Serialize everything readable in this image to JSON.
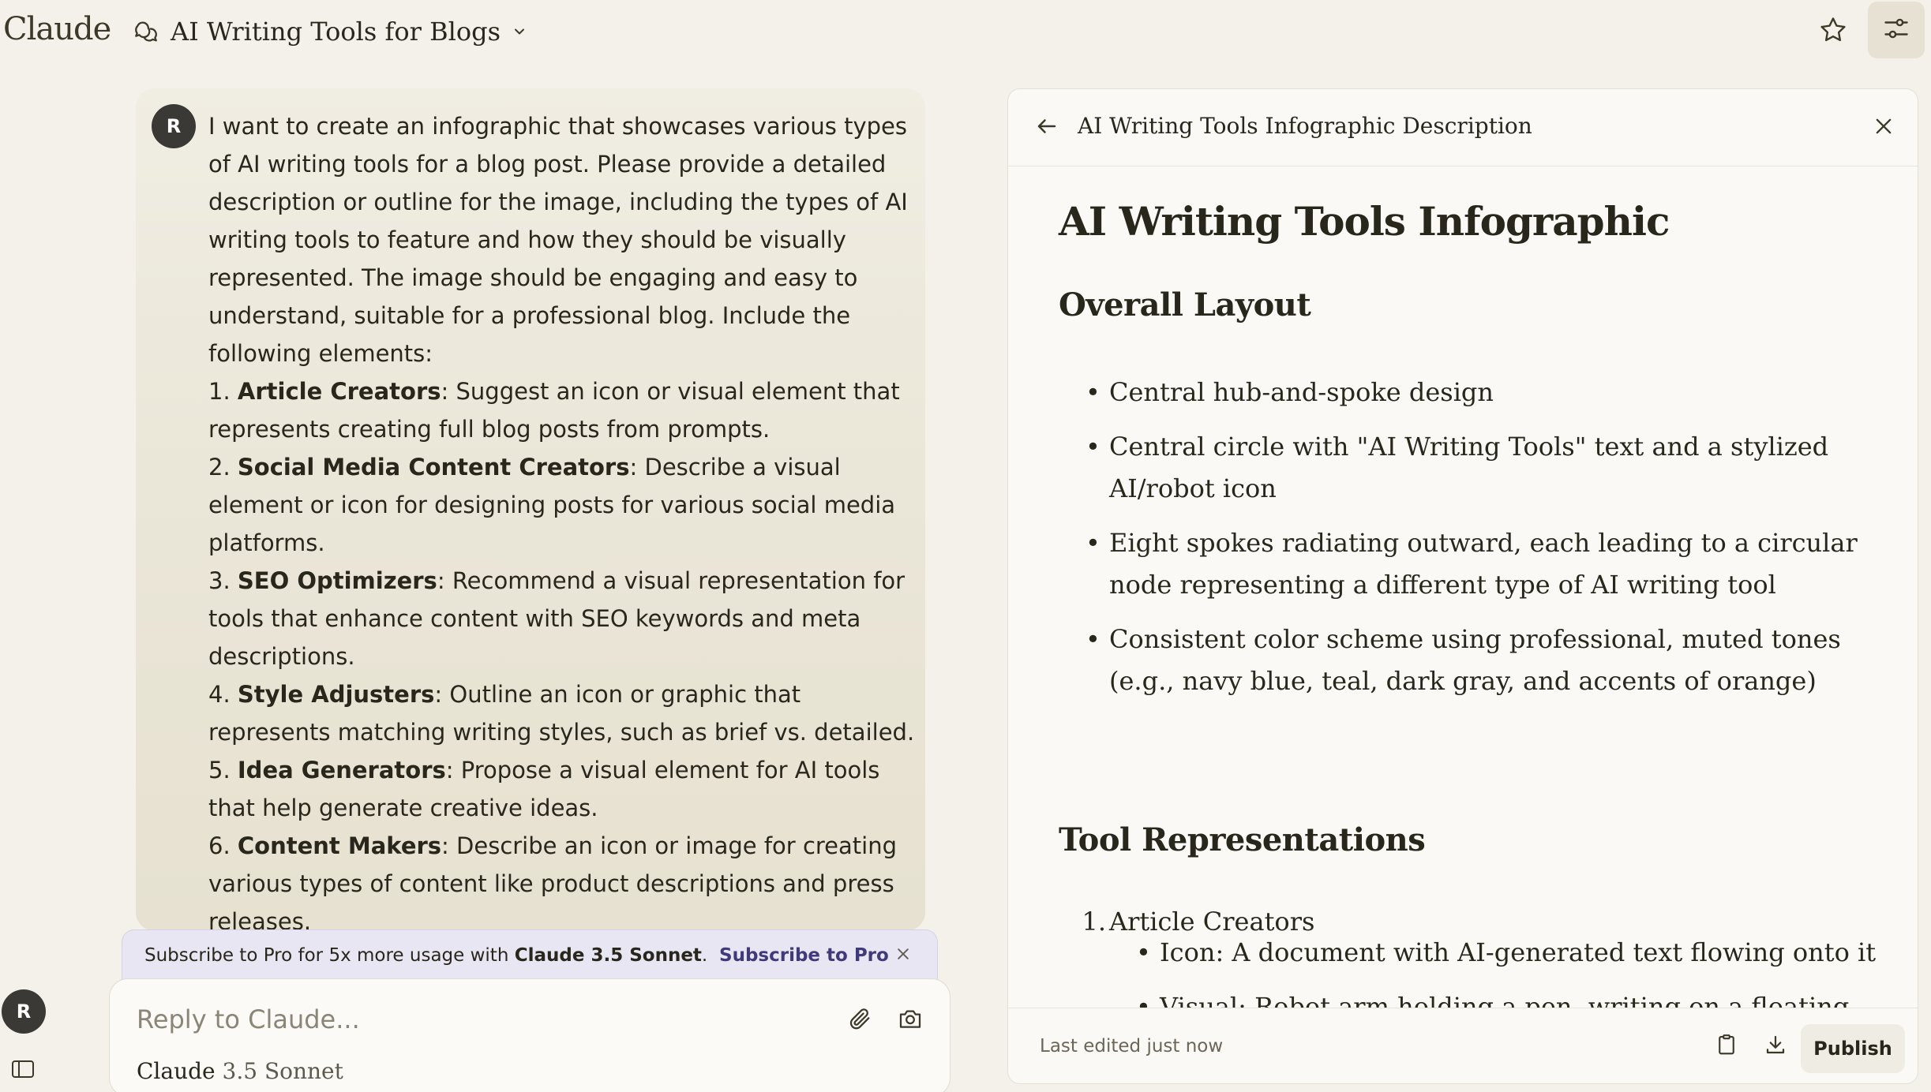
{
  "app": {
    "logo": "Claude"
  },
  "header": {
    "chat_title": "AI Writing Tools for Blogs"
  },
  "message": {
    "avatar": "R",
    "intro": "I want to create an infographic that showcases various types of AI writing tools for a blog post. Please provide a detailed description or outline for the image, including the types of AI writing tools to feature and how they should be visually represented. The image should be engaging and easy to understand, suitable for a professional blog. Include the following elements:",
    "items": [
      {
        "num": "1.",
        "title": "Article Creators",
        "text": ": Suggest an icon or visual element that represents creating full blog posts from prompts."
      },
      {
        "num": "2.",
        "title": "Social Media Content Creators",
        "text": ": Describe a visual element or icon for designing posts for various social media platforms."
      },
      {
        "num": "3.",
        "title": "SEO Optimizers",
        "text": ": Recommend a visual representation for tools that enhance content with SEO keywords and meta descriptions."
      },
      {
        "num": "4.",
        "title": "Style Adjusters",
        "text": ": Outline an icon or graphic that represents matching writing styles, such as brief vs. detailed."
      },
      {
        "num": "5.",
        "title": "Idea Generators",
        "text": ": Propose a visual element for AI tools that help generate creative ideas."
      },
      {
        "num": "6.",
        "title": "Content Makers",
        "text": ": Describe an icon or image for creating various types of content like product descriptions and press releases."
      }
    ]
  },
  "banner": {
    "text_prefix": "Subscribe to Pro for 5x more usage with ",
    "text_bold": "Claude 3.5 Sonnet",
    "text_suffix": ".",
    "link": "Subscribe to Pro"
  },
  "reply": {
    "placeholder": "Reply to Claude...",
    "model_name": "Claude",
    "model_version": "3.5 Sonnet"
  },
  "sidebar": {
    "avatar": "R"
  },
  "panel": {
    "title": "AI Writing Tools Infographic Description",
    "doc_title": "AI Writing Tools Infographic",
    "section1": {
      "heading": "Overall Layout",
      "bullets": [
        "Central hub-and-spoke design",
        "Central circle with \"AI Writing Tools\" text and a stylized AI/robot icon",
        "Eight spokes radiating outward, each leading to a circular node representing a different type of AI writing tool",
        "Consistent color scheme using professional, muted tones (e.g., navy blue, teal, dark gray, and accents of orange)"
      ]
    },
    "section2": {
      "heading": "Tool Representations",
      "items": [
        {
          "num": "1.",
          "title": "Article Creators",
          "bullets": [
            "Icon: A document with AI-generated text flowing onto it",
            "Visual: Robot arm holding a pen, writing on a floating document"
          ]
        }
      ]
    },
    "footer": {
      "last_edited": "Last edited just now",
      "publish": "Publish"
    }
  }
}
